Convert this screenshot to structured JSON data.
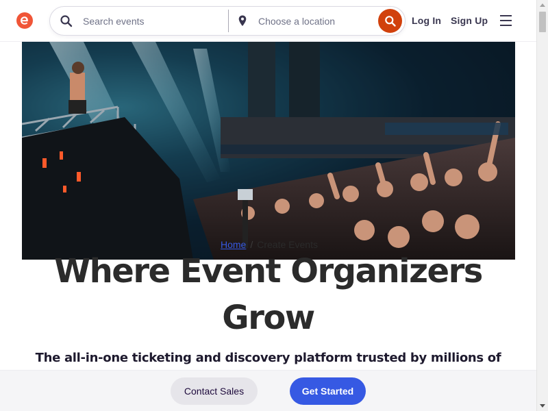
{
  "header": {
    "logo_icon": "eventbrite-e-logo-icon",
    "search_placeholder": "Search events",
    "location_placeholder": "Choose a location",
    "login_label": "Log In",
    "signup_label": "Sign Up",
    "menu_icon": "hamburger-menu-icon"
  },
  "hero": {
    "image_description": "concert-crowd-photo",
    "breadcrumb": {
      "home_label": "Home",
      "current_label": "Create Events"
    }
  },
  "main": {
    "headline_line1": "Where Event Organizers",
    "headline_line2": "Grow",
    "subheadline": "The all-in-one ticketing and discovery platform trusted by millions of"
  },
  "cta": {
    "contact_label": "Contact Sales",
    "start_label": "Get Started"
  },
  "colors": {
    "brand_orange": "#f05537",
    "search_button": "#d1410c",
    "primary_blue": "#3659e3",
    "text_dark": "#2b2b2b"
  }
}
